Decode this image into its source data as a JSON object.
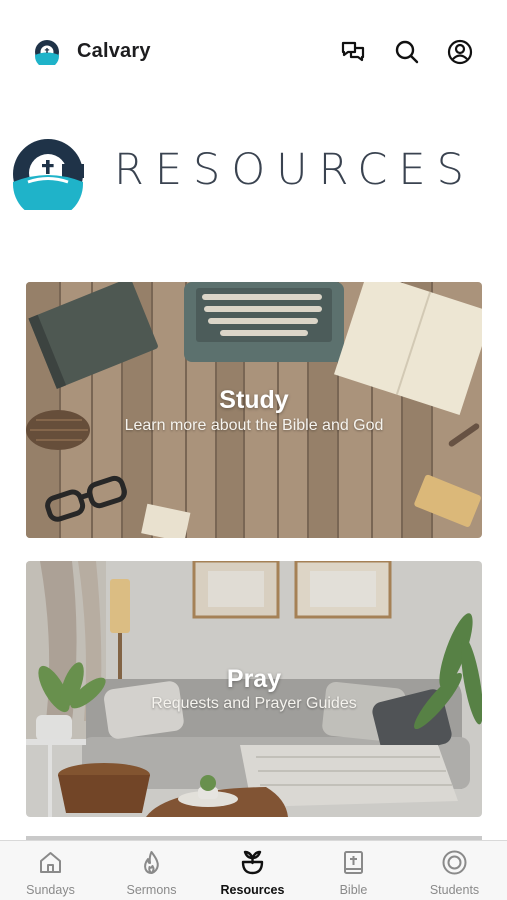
{
  "header": {
    "app_name": "Calvary",
    "icons": [
      "messages-icon",
      "search-icon",
      "account-icon"
    ]
  },
  "hero": {
    "title": "RESOURCES"
  },
  "cards": [
    {
      "title": "Study",
      "subtitle": "Learn more about the Bible and God"
    },
    {
      "title": "Pray",
      "subtitle": "Requests and Prayer Guides"
    }
  ],
  "nav": {
    "items": [
      {
        "label": "Sundays",
        "icon": "home-icon"
      },
      {
        "label": "Sermons",
        "icon": "flame-icon"
      },
      {
        "label": "Resources",
        "icon": "plant-icon",
        "active": true
      },
      {
        "label": "Bible",
        "icon": "bible-icon"
      },
      {
        "label": "Students",
        "icon": "target-icon"
      }
    ]
  },
  "colors": {
    "brand_navy": "#1f3348",
    "brand_teal": "#1fb3c9",
    "active": "#111111",
    "inactive": "#8a8a8a"
  }
}
